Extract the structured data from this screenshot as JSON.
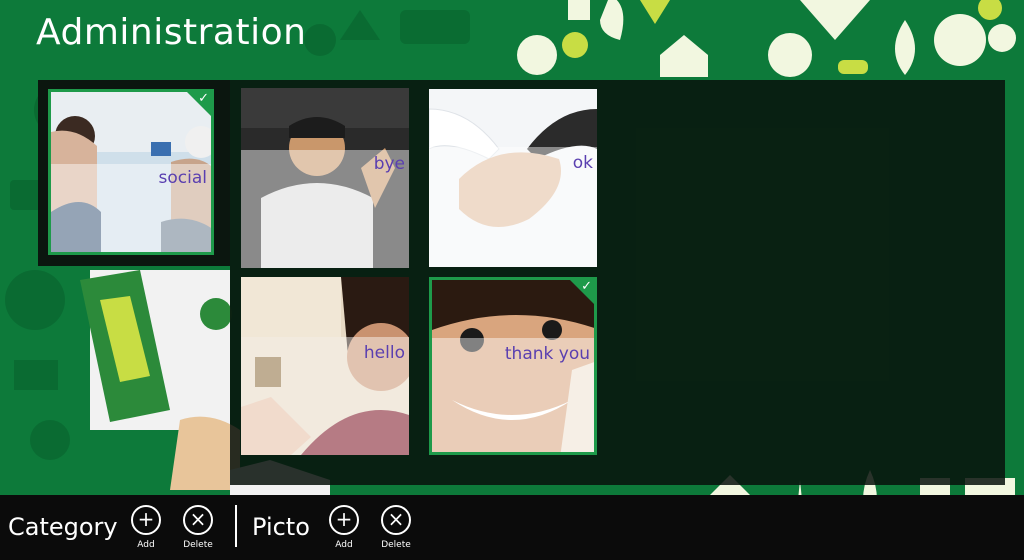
{
  "page": {
    "title": "Administration"
  },
  "colors": {
    "background": "#0d7a3a",
    "accent": "#1e9a4a",
    "label": "#5a3fb0"
  },
  "tiles": [
    {
      "label": "social",
      "selected": true
    },
    {
      "label": "bye",
      "selected": false
    },
    {
      "label": "ok",
      "selected": false
    },
    {
      "label": "hello",
      "selected": false
    },
    {
      "label": "thank you",
      "selected": true
    }
  ],
  "appbar": {
    "category": {
      "label": "Category",
      "add": {
        "icon": "add-icon",
        "glyph": "+",
        "caption": "Add"
      },
      "delete": {
        "icon": "delete-icon",
        "glyph": "×",
        "caption": "Delete"
      }
    },
    "picto": {
      "label": "Picto",
      "add": {
        "icon": "add-icon",
        "glyph": "+",
        "caption": "Add"
      },
      "delete": {
        "icon": "delete-icon",
        "glyph": "×",
        "caption": "Delete"
      }
    }
  }
}
